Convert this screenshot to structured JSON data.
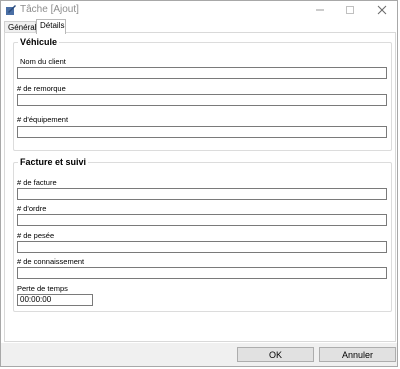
{
  "window": {
    "title": "Tâche [Ajout]",
    "minimize_icon": "minimize-icon",
    "maximize_icon": "maximize-icon",
    "close_icon": "close-icon"
  },
  "tabs": [
    {
      "label": "Général",
      "active": false
    },
    {
      "label": "Détails",
      "active": true
    }
  ],
  "vehicule": {
    "legend": "Véhicule",
    "fields": [
      {
        "label": "Nom du client",
        "value": ""
      },
      {
        "label": "# de remorque",
        "value": ""
      },
      {
        "label": "# d'équipement",
        "value": ""
      }
    ]
  },
  "facture": {
    "legend": "Facture et suivi",
    "fields": [
      {
        "label": "# de facture",
        "value": ""
      },
      {
        "label": "# d'ordre",
        "value": ""
      },
      {
        "label": "# de pesée",
        "value": ""
      },
      {
        "label": "# de connaissement",
        "value": ""
      }
    ],
    "time_field": {
      "label": "Perte de temps",
      "value": "00:00:00"
    }
  },
  "buttons": {
    "ok": "OK",
    "cancel": "Annuler"
  }
}
